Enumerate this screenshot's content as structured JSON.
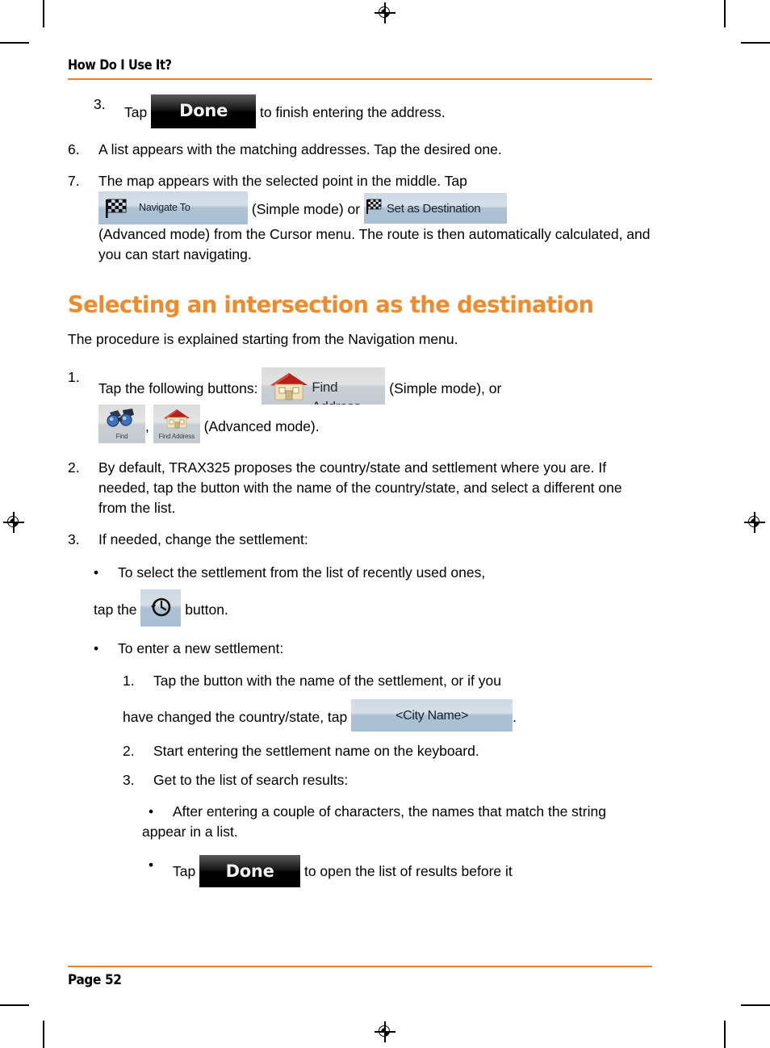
{
  "document": {
    "running_header": "How Do I Use It?",
    "page_label": "Page 52",
    "accent_color": "#E8822A",
    "heading_color": "#ED8B2D"
  },
  "buttons": {
    "done": "Done",
    "navigate_to": "Navigate To",
    "set_as_destination": "Set as Destination",
    "find_address": "Find Address",
    "find_small": "Find",
    "find_address_small": "Find Address",
    "city_name": "<City Name>",
    "history": ""
  },
  "steps": [
    {
      "marker": "3.",
      "parts": [
        {
          "type": "text",
          "value": "Tap "
        },
        {
          "type": "button",
          "value": "done"
        },
        {
          "type": "text",
          "value": " to finish entering the address."
        }
      ],
      "text_before": "Tap",
      "text_after": "to finish entering the address."
    },
    {
      "marker": "6.",
      "text": "A list appears with the matching addresses. Tap the desired one."
    },
    {
      "marker": "7.",
      "text_lead": "The map appears with the selected point in the middle. Tap",
      "mid_1": "(Simple mode) or",
      "text_tail": "(Advanced mode) from the Cursor menu. The route is then automatically calculated, and you can start navigating."
    }
  ],
  "section": {
    "title": "Selecting an intersection as the destination",
    "intro": "The procedure is explained starting from the Navigation menu.",
    "items": [
      {
        "marker": "1.",
        "lead": "Tap the following buttons:",
        "mid": "(Simple mode), or",
        "comma": ",",
        "tail": "(Advanced mode)."
      },
      {
        "marker": "2.",
        "text": "By default, TRAX325 proposes the country/state and settlement where you are. If needed, tap the button with the name of the country/state, and select a different one from the list."
      },
      {
        "marker": "3.",
        "text": "If needed, change the settlement:"
      }
    ],
    "bullets": [
      {
        "marker": "•",
        "lead": "To select the settlement from the list of recently used ones,",
        "tap_the": "tap the",
        "tail": "button."
      },
      {
        "marker": "•",
        "text": "To enter a new settlement:"
      }
    ],
    "sub_steps": [
      {
        "marker": "1.",
        "lead": "Tap the button with the name of the settlement, or if you",
        "cont": "have changed the country/state, tap",
        "tail": "."
      },
      {
        "marker": "2.",
        "text": "Start entering the settlement name on the keyboard."
      },
      {
        "marker": "3.",
        "text": "Get to the list of search results:"
      }
    ],
    "sub_bullets": [
      {
        "marker": "•",
        "text": "After entering a couple of characters, the names that match the string appear in a list."
      },
      {
        "marker": "•",
        "lead": "Tap",
        "tail": "to open the list of results before it"
      }
    ]
  }
}
